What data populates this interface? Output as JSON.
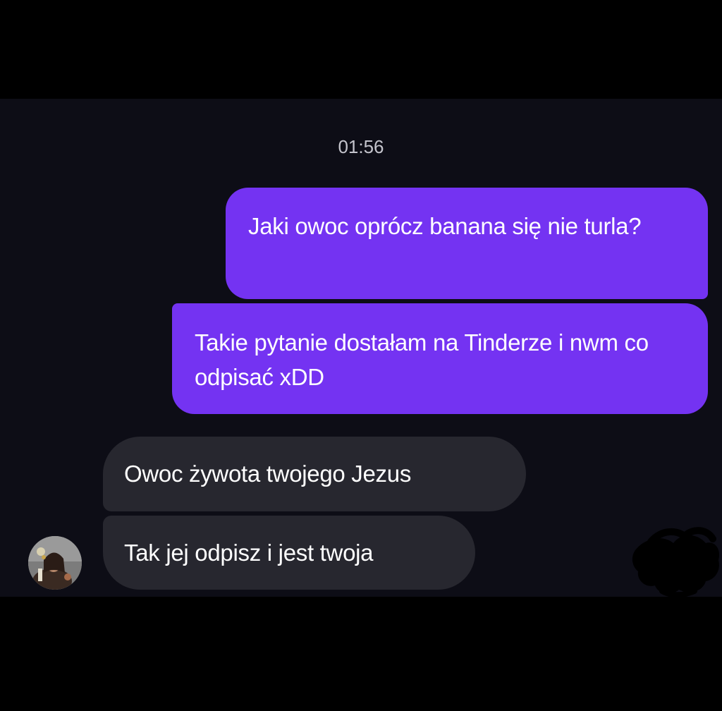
{
  "conversation": {
    "timestamp": "01:56",
    "messages": [
      {
        "sender": "me",
        "text": "Jaki owoc oprócz banana się nie turla?"
      },
      {
        "sender": "me",
        "text": "Takie pytanie dostałam na Tinderze i nwm co odpisać xDD"
      },
      {
        "sender": "other",
        "text": "Owoc żywota twojego Jezus"
      },
      {
        "sender": "other",
        "text": "Tak jej odpisz i jest twoja"
      }
    ]
  },
  "colors": {
    "background": "#000000",
    "chat_background": "#0d0d16",
    "sent_bubble": "#7433f2",
    "received_bubble": "#27272f",
    "timestamp_text": "#c4c4cc"
  },
  "icons": {
    "avatar": "contact-avatar",
    "redaction": "scribble-redaction"
  }
}
